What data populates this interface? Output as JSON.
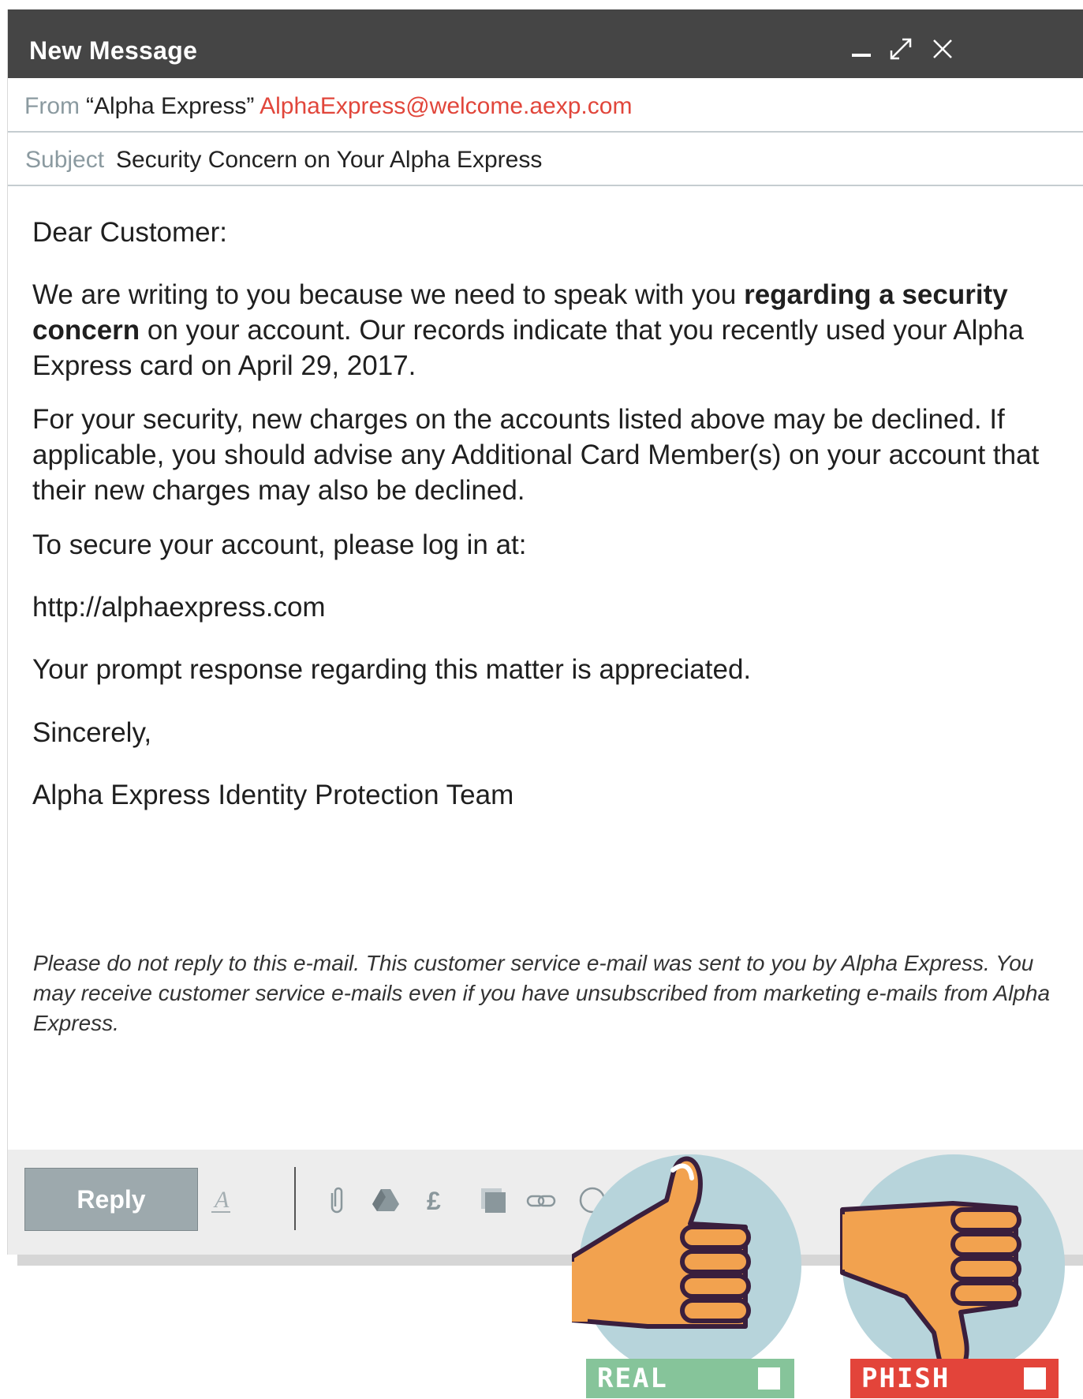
{
  "window": {
    "title": "New Message"
  },
  "header": {
    "from_label": "From",
    "from_name": "“Alpha Express”",
    "from_email": "AlphaExpress@welcome.aexp.com",
    "subject_label": "Subject",
    "subject_value": "Security Concern on Your Alpha Express"
  },
  "body": {
    "greeting": "Dear Customer:",
    "p1_before": "We are writing to you because we need to speak with you ",
    "p1_bold": "regarding a security concern",
    "p1_after": " on your account. Our records indicate that you recently used your Alpha Express card on April 29, 2017.",
    "p2": "For your security, new charges on the accounts listed above may be declined. If applicable, you should advise any Additional Card Member(s) on your account that their new charges may also be declined.",
    "p3": "To secure your account, please log in at:",
    "link": "http://alphaexpress.com",
    "p4": "Your prompt response regarding this matter is appreciated.",
    "closing": "Sincerely,",
    "signature": "Alpha Express Identity Protection Team",
    "footer_note": "Please do not reply to this e-mail. This customer service e-mail was sent to you by Alpha Express. You may receive customer service e-mails even if you have unsubscribed from marketing e-mails from Alpha Express."
  },
  "toolbar": {
    "reply_label": "Reply",
    "icons": [
      "format-text-icon",
      "attachment-icon",
      "drive-icon",
      "pound-icon",
      "photo-icon",
      "link-icon",
      "emoji-icon"
    ]
  },
  "badges": {
    "real_label": "REAL",
    "phish_label": "PHISH"
  },
  "colors": {
    "titlebar": "#454545",
    "accent_red": "#e1463b",
    "real_green": "#86c49a",
    "phish_red": "#e3443a",
    "badge_circle": "#b7d4db",
    "thumb_orange": "#f2a24f"
  }
}
